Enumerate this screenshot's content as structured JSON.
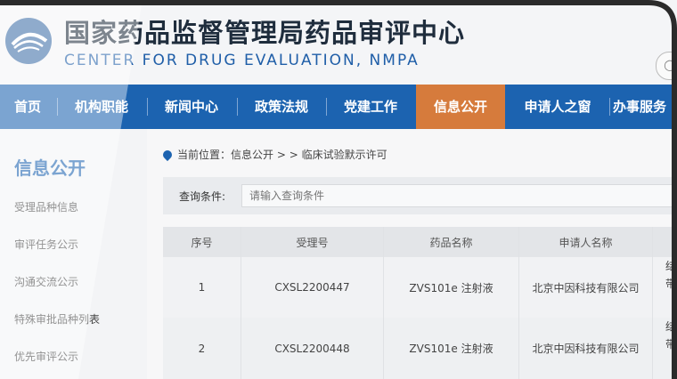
{
  "header": {
    "title_cn": "国家药品监督管理局药品审评中心",
    "title_en": "CENTER FOR DRUG EVALUATION, NMPA"
  },
  "nav": {
    "items": [
      "首页",
      "机构职能",
      "新闻中心",
      "政策法规",
      "党建工作",
      "信息公开",
      "申请人之窗",
      "办事服务"
    ],
    "active_index": 5
  },
  "sidebar": {
    "title": "信息公开",
    "items": [
      "受理品种信息",
      "审评任务公示",
      "沟通交流公示",
      "特殊审批品种列表",
      "优先审评公示"
    ]
  },
  "breadcrumb": {
    "prefix": "当前位置：信息公开",
    "sep": "> >",
    "current": "临床试验默示许可"
  },
  "query": {
    "label": "查询条件:",
    "placeholder": "请输入查询条件"
  },
  "table": {
    "headers": [
      "序号",
      "受理号",
      "药品名称",
      "申请人名称",
      ""
    ],
    "rows": [
      {
        "no": "1",
        "accept_no": "CXSL2200447",
        "drug": "ZVS101e 注射液",
        "applicant": "北京中因科技有限公司",
        "extra_a": "结",
        "extra_b": "带"
      },
      {
        "no": "2",
        "accept_no": "CXSL2200448",
        "drug": "ZVS101e 注射液",
        "applicant": "北京中因科技有限公司",
        "extra_a": "结",
        "extra_b": "带"
      }
    ]
  },
  "colors": {
    "nav_bg": "#1c63b0",
    "nav_active": "#d67b3c",
    "brand_blue": "#1f5ea8"
  }
}
